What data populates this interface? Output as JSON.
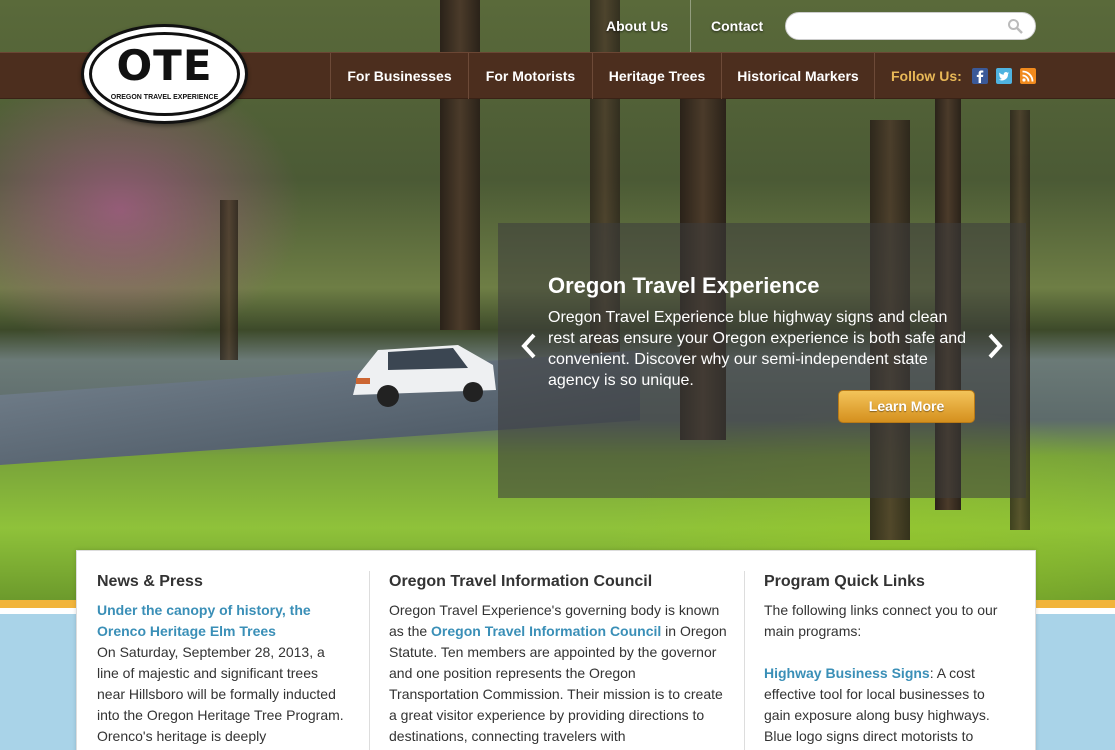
{
  "top_links": {
    "about": "About Us",
    "contact": "Contact"
  },
  "search": {
    "placeholder": ""
  },
  "logo": {
    "letters": "OTE",
    "subtitle": "OREGON TRAVEL EXPERIENCE"
  },
  "nav": [
    "For Businesses",
    "For Motorists",
    "Heritage Trees",
    "Historical Markers"
  ],
  "follow": {
    "label": "Follow Us:",
    "icons": [
      "facebook-icon",
      "twitter-icon",
      "rss-icon"
    ]
  },
  "slide": {
    "title": "Oregon Travel Experience",
    "text": "Oregon Travel Experience blue highway signs and clean rest areas ensure your Oregon experience is both safe and convenient. Discover why our semi-independent state agency is so unique.",
    "button": "Learn More"
  },
  "news": {
    "heading": "News & Press",
    "link": "Under the canopy of history, the Orenco Heritage Elm Trees",
    "body": "On Saturday, September 28, 2013, a line of majestic and significant trees near Hillsboro will be formally inducted into the Oregon Heritage Tree Program. Orenco's heritage is deeply"
  },
  "council": {
    "heading": "Oregon Travel Information Council",
    "pre": "Oregon Travel Experience's governing body is known as the",
    "link": "Oregon Travel Information Council",
    "post": "in Oregon Statute. Ten members are appointed by the governor and one position represents the Oregon Transportation Commission. Their mission is to create a great visitor experience by providing directions to destinations, connecting travelers with"
  },
  "quick": {
    "heading": "Program Quick Links",
    "intro": "The following links connect you to our main programs:",
    "link": "Highway Business Signs",
    "desc": ": A cost effective tool for local businesses to gain exposure along busy highways. Blue logo signs direct motorists to"
  },
  "colors": {
    "nav_bg": "#4c2e1e",
    "accent": "#e8b857",
    "link": "#3a8fb7",
    "button": "#e2a43a"
  }
}
